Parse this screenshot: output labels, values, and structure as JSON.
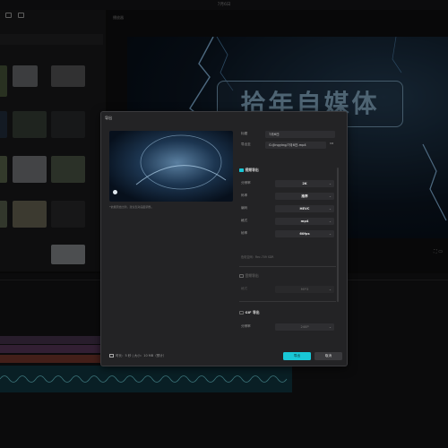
{
  "window": {
    "title": "7月6日"
  },
  "media": {
    "toolbar": [
      {
        "label": ""
      },
      {
        "label": ""
      }
    ],
    "thumbs": [
      {
        "color": "#4c5a3c",
        "label": ""
      },
      {
        "color": "#6d6f73",
        "label": ""
      },
      {
        "color": "#5a5a5c",
        "label": ""
      },
      {
        "color": "#233140",
        "label": ""
      },
      {
        "color": "#39423a",
        "label": ""
      },
      {
        "color": "#2a2c2e",
        "label": ""
      },
      {
        "color": "#5e6b4f",
        "label": ""
      },
      {
        "color": "#7b7d80",
        "label": ""
      },
      {
        "color": "#4f5a4a",
        "label": ""
      },
      {
        "color": "#5b6450",
        "label": ""
      },
      {
        "color": "#6e6a58",
        "label": ""
      },
      {
        "color": "#2b2b2d",
        "label": ""
      },
      {
        "color": "#8a8f93",
        "label": ""
      }
    ]
  },
  "player": {
    "title": "播放器",
    "overlay_text": "拾年自媒体"
  },
  "timeline": {
    "tracks": [
      {
        "color": "#4a3550"
      },
      {
        "color": "#5b3a5e"
      },
      {
        "color": "#7a3a2e"
      },
      {
        "color": "#1c6a78"
      }
    ]
  },
  "export_dialog": {
    "title": "导出",
    "preview_tip": "*依据原始比例，建议您对画面调整。",
    "name_label": "标题",
    "name_value": "7月6日",
    "path_label": "导出至",
    "path_value": "G:/Jingying/7月6日.mp4",
    "video_section": "视频导出",
    "video_checked": true,
    "rows": [
      {
        "label": "分辨率",
        "value": "2K"
      },
      {
        "label": "码率",
        "value": "推荐"
      },
      {
        "label": "编码",
        "value": "HEVC"
      },
      {
        "label": "格式",
        "value": "mp4"
      },
      {
        "label": "帧率",
        "value": "60fps"
      }
    ],
    "color_space": "色彩空间：Rec.709 SDR",
    "audio_section": "音频导出",
    "audio_row": {
      "label": "格式",
      "value": "MP3"
    },
    "gif_section": "GIF 导出",
    "gif_checked": false,
    "gif_row": {
      "label": "分辨率",
      "value": "240P"
    },
    "footer_info": "时长：5 秒 | 大小：10 MB（预计）",
    "export_label": "导出",
    "cancel_label": "取消"
  },
  "colors": {
    "accent": "#19c7d6"
  }
}
